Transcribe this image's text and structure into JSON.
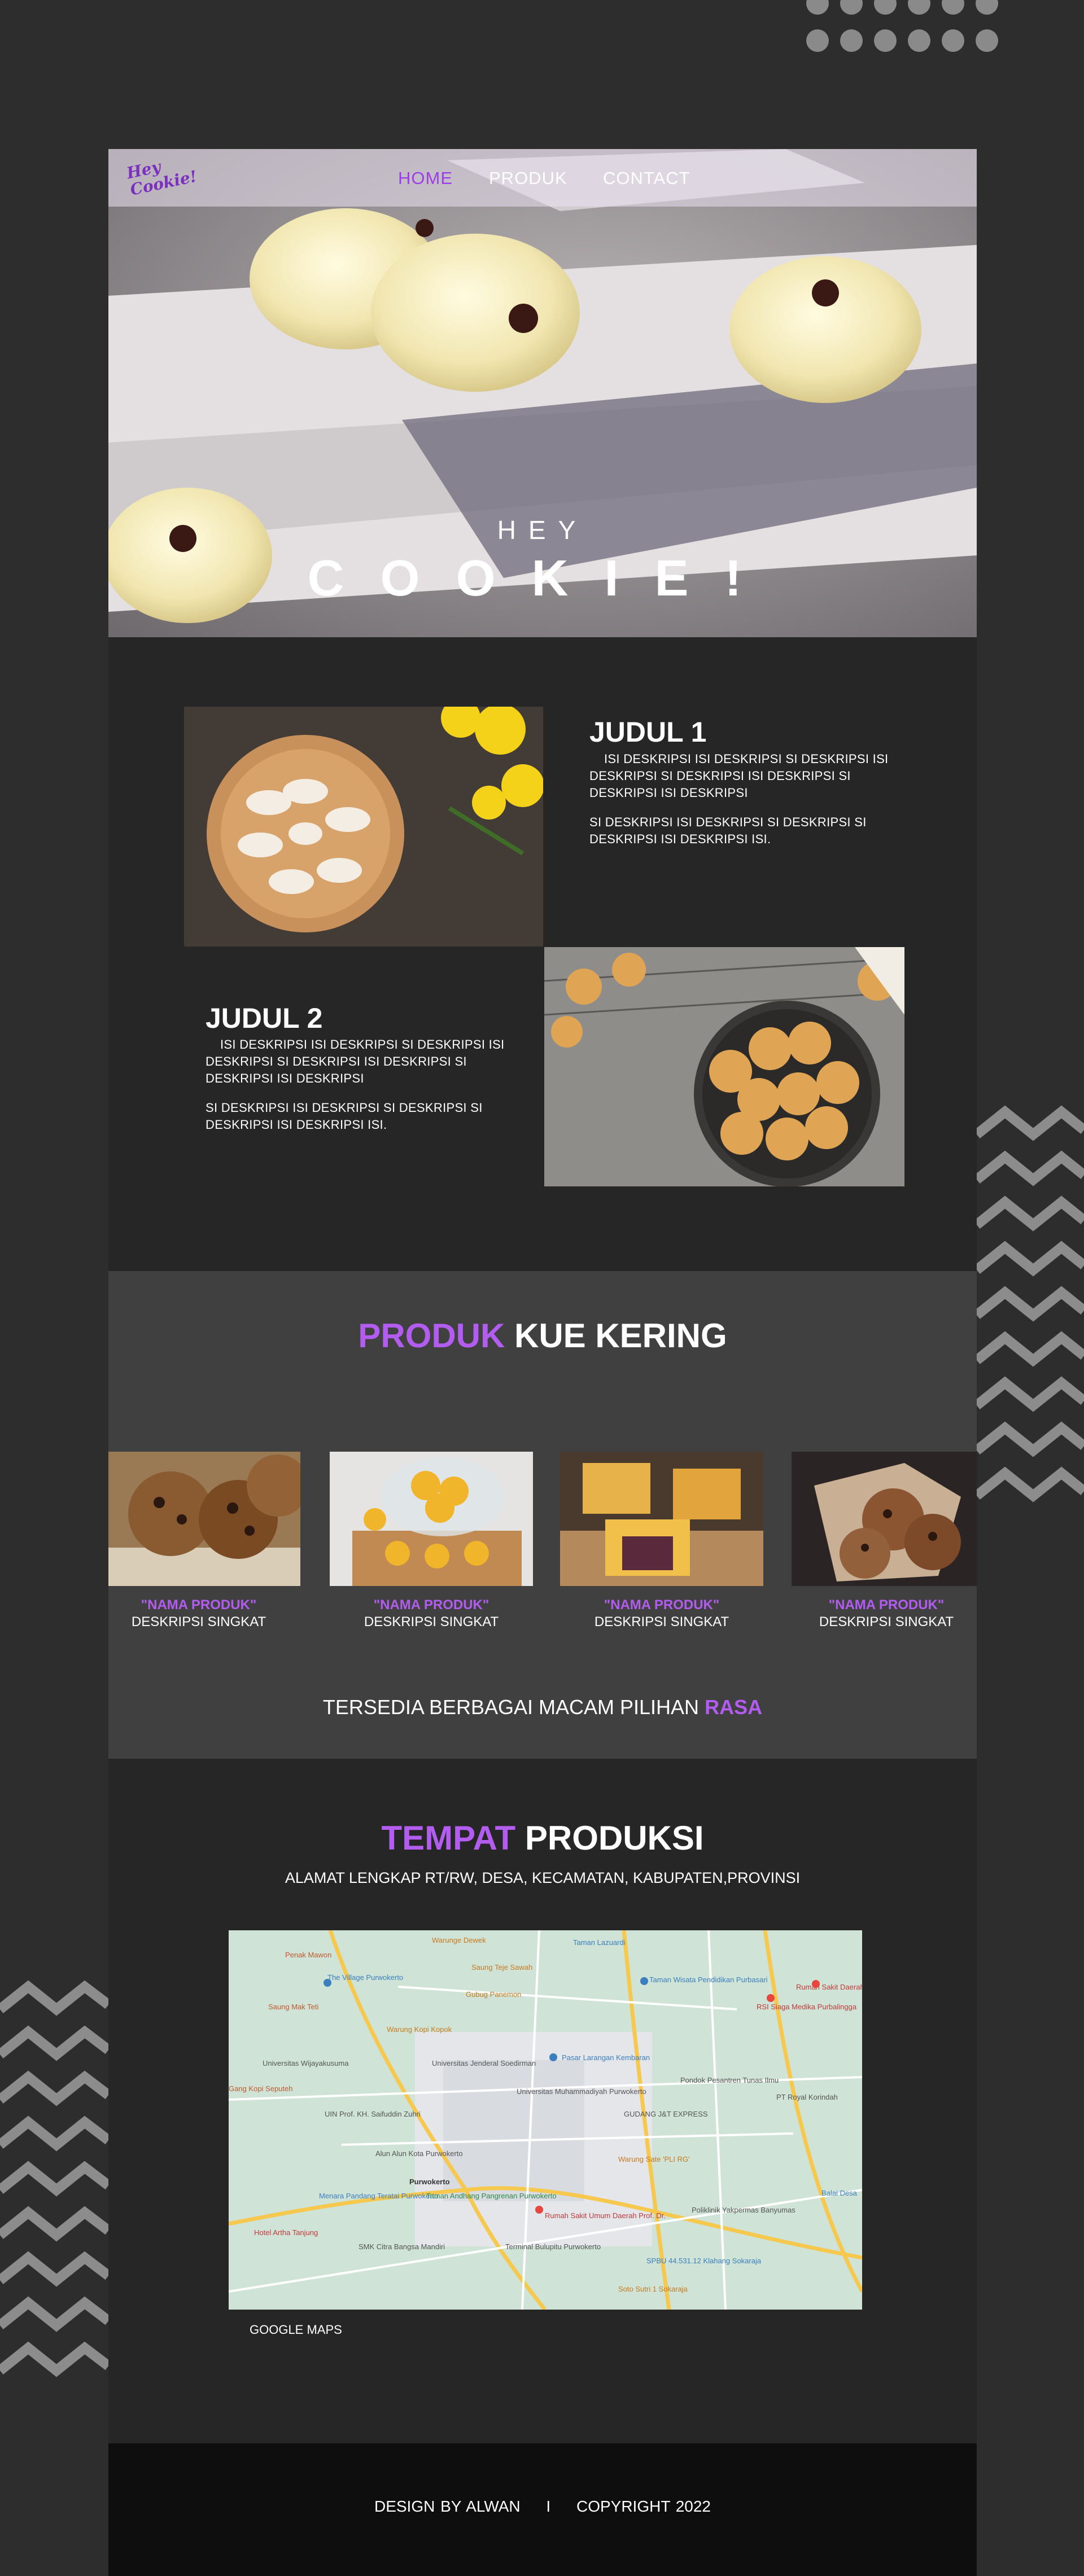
{
  "nav": {
    "logo": "Hey Cookie!",
    "home": "HOME",
    "produk": "PRODUK",
    "contact": "CONTACT"
  },
  "hero": {
    "kicker": "HEY",
    "title": "COOKIE!"
  },
  "about": [
    {
      "title": "JUDUL 1",
      "p1": "ISI DESKRIPSI ISI DESKRIPSI SI DESKRIPSI ISI DESKRIPSI   SI DESKRIPSI ISI DESKRIPSI SI DESKRIPSI ISI DESKRIPSI",
      "p2": "SI DESKRIPSI ISI DESKRIPSI  SI DESKRIPSI SI DESKRIPSI ISI DESKRIPSI  ISI."
    },
    {
      "title": "JUDUL 2",
      "p1": "ISI DESKRIPSI ISI DESKRIPSI SI DESKRIPSI ISI DESKRIPSI   SI DESKRIPSI ISI DESKRIPSI SI DESKRIPSI ISI DESKRIPSI",
      "p2": "SI DESKRIPSI ISI DESKRIPSI  SI DESKRIPSI SI DESKRIPSI ISI DESKRIPSI  ISI."
    }
  ],
  "products": {
    "title_accent": "PRODUK",
    "title_rest": "KUE KERING",
    "items": [
      {
        "name": "\"NAMA PRODUK\"",
        "desc": "DESKRIPSI SINGKAT"
      },
      {
        "name": "\"NAMA PRODUK\"",
        "desc": "DESKRIPSI SINGKAT"
      },
      {
        "name": "\"NAMA PRODUK\"",
        "desc": "DESKRIPSI SINGKAT"
      },
      {
        "name": "\"NAMA PRODUK\"",
        "desc": "DESKRIPSI SINGKAT"
      }
    ],
    "tagline": "TERSEDIA BERBAGAI MACAM PILIHAN",
    "tagline_accent": "RASA"
  },
  "location": {
    "title_accent": "TEMPAT",
    "title_rest": "PRODUKSI",
    "address": "ALAMAT LENGKAP RT/RW, DESA, KECAMATAN, KABUPATEN,PROVINSI",
    "map_caption": "GOOGLE MAPS",
    "map_labels": [
      "Warunge Dewek",
      "Penak Mawon",
      "Taman Lazuardi",
      "The Village Purwokerto",
      "Saung Teje Sawah",
      "Gubug Panemon",
      "Taman Wisata Pendidikan Purbasari",
      "Rumah Sakit Daerah (RSUD)",
      "RSI Siaga Medika Purbalingga",
      "Saung Mak Teti",
      "Warung Kopi Kopok",
      "Universitas Jenderal Soedirman",
      "Pasar Larangan Kembaran",
      "Universitas Muhammadiyah Purwokerto",
      "Pondok Pesantren Tunas Ilmu",
      "PT Royal Korindah",
      "GUDANG J&T EXPRESS",
      "UIN Prof. KH. Saifuddin Zuhri",
      "Alun Alun Kota Purwokerto",
      "Purwokerto",
      "Menara Pandang Teratai Purwokerto",
      "Taman Andhang Pangrenan Purwokerto",
      "Warung Sate 'PLI RG'",
      "Rumah Sakit Umum Daerah Prof. Dr.",
      "Poliklinik Yakpermas Banyumas",
      "Balai Desa",
      "Hotel Artha Tanjung",
      "SMK Citra Bangsa Mandiri",
      "Terminal Bulupitu Purwokerto",
      "SPBU 44.531.12 Klahang Sokaraja",
      "Soto Sutri 1 Sokaraja",
      "Universitas Wijayakusuma",
      "Gang Kopi Seputeh"
    ]
  },
  "footer": {
    "credit": "DESIGN BY ALWAN",
    "sep": "I",
    "copyright": "COPYRIGHT 2022"
  },
  "colors": {
    "accent": "#b25cf0",
    "bg": "#2d2d2e",
    "section": "#404041",
    "footer": "#0e0e0e"
  }
}
